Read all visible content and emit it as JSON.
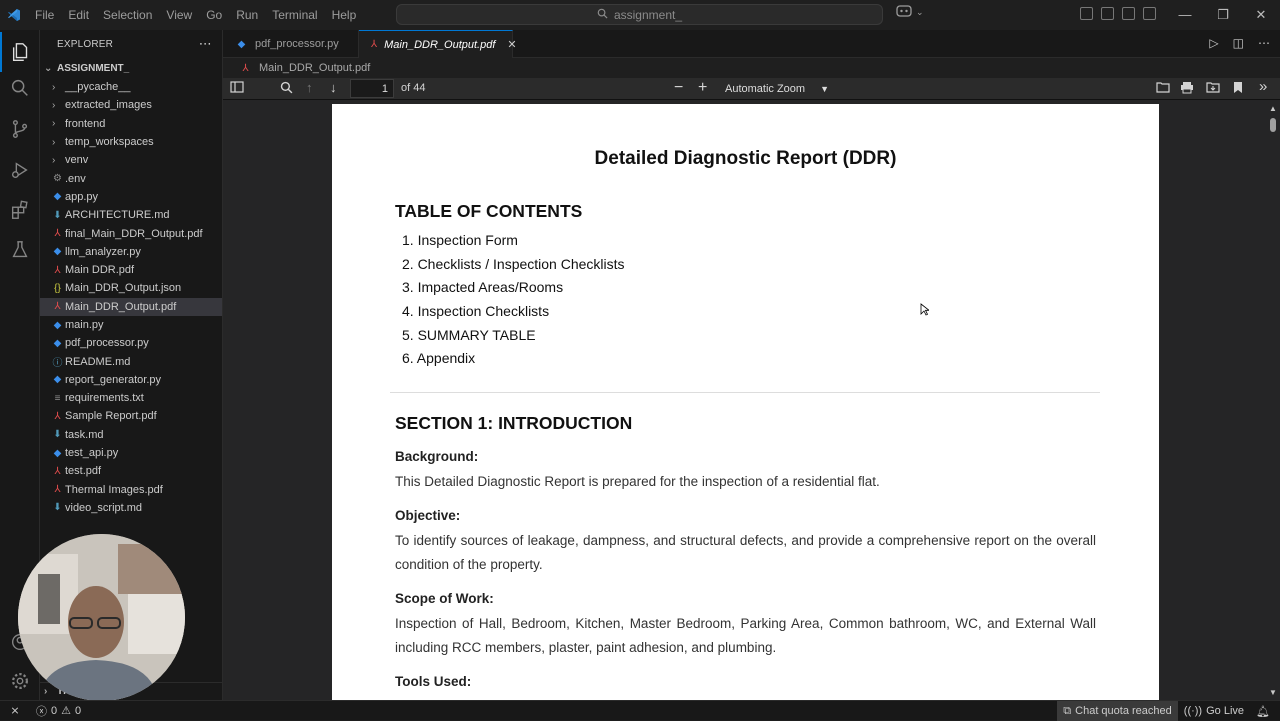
{
  "titlebar": {
    "menu": [
      "File",
      "Edit",
      "Selection",
      "View",
      "Go",
      "Run",
      "Terminal",
      "Help"
    ],
    "search_text": "assignment_"
  },
  "explorer": {
    "header": "EXPLORER",
    "root": "ASSIGNMENT_",
    "items": [
      {
        "label": "__pycache__",
        "type": "folder"
      },
      {
        "label": "extracted_images",
        "type": "folder"
      },
      {
        "label": "frontend",
        "type": "folder"
      },
      {
        "label": "temp_workspaces",
        "type": "folder"
      },
      {
        "label": "venv",
        "type": "folder"
      },
      {
        "label": ".env",
        "type": "env"
      },
      {
        "label": "app.py",
        "type": "py"
      },
      {
        "label": "ARCHITECTURE.md",
        "type": "md"
      },
      {
        "label": "final_Main_DDR_Output.pdf",
        "type": "pdf"
      },
      {
        "label": "llm_analyzer.py",
        "type": "py"
      },
      {
        "label": "Main DDR.pdf",
        "type": "pdf"
      },
      {
        "label": "Main_DDR_Output.json",
        "type": "json"
      },
      {
        "label": "Main_DDR_Output.pdf",
        "type": "pdf",
        "selected": true
      },
      {
        "label": "main.py",
        "type": "py"
      },
      {
        "label": "pdf_processor.py",
        "type": "py"
      },
      {
        "label": "README.md",
        "type": "info"
      },
      {
        "label": "report_generator.py",
        "type": "py"
      },
      {
        "label": "requirements.txt",
        "type": "txt"
      },
      {
        "label": "Sample Report.pdf",
        "type": "pdf"
      },
      {
        "label": "task.md",
        "type": "md"
      },
      {
        "label": "test_api.py",
        "type": "py"
      },
      {
        "label": "test.pdf",
        "type": "pdf"
      },
      {
        "label": "Thermal Images.pdf",
        "type": "pdf"
      },
      {
        "label": "video_script.md",
        "type": "md"
      }
    ],
    "timeline_label": "TI"
  },
  "tabs": [
    {
      "label": "pdf_processor.py",
      "active": false
    },
    {
      "label": "Main_DDR_Output.pdf",
      "active": true
    }
  ],
  "breadcrumb": "Main_DDR_Output.pdf",
  "pdf_toolbar": {
    "page": "1",
    "of_pages": "of 44",
    "zoom": "Automatic Zoom"
  },
  "document": {
    "title": "Detailed Diagnostic Report (DDR)",
    "toc_heading": "TABLE OF CONTENTS",
    "toc": [
      "1. Inspection Form",
      "2. Checklists / Inspection Checklists",
      "3. Impacted Areas/Rooms",
      "4. Inspection Checklists",
      "5. SUMMARY TABLE",
      "6. Appendix"
    ],
    "section_heading": "SECTION 1: INTRODUCTION",
    "background_h": "Background:",
    "background_p": "This Detailed Diagnostic Report is prepared for the inspection of a residential flat.",
    "objective_h": "Objective:",
    "objective_p": "To identify sources of leakage, dampness, and structural defects, and provide a comprehensive report on the overall condition of the property.",
    "scope_h": "Scope of Work:",
    "scope_p": "Inspection of Hall, Bedroom, Kitchen, Master Bedroom, Parking Area, Common bathroom, WC, and External Wall including RCC members, plaster, paint adhesion, and plumbing.",
    "tools_h": "Tools Used:"
  },
  "statusbar": {
    "errors": "0",
    "warnings": "0",
    "chat_quota": "Chat quota reached",
    "go_live": "Go Live"
  }
}
